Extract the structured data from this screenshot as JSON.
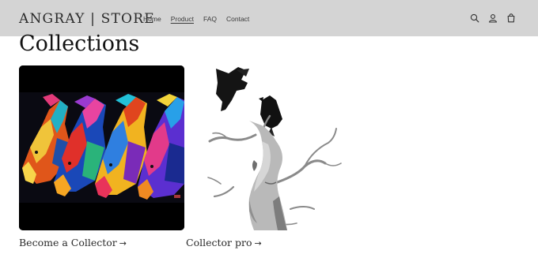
{
  "header": {
    "logo": "ANGRAY | STORE",
    "nav": [
      {
        "label": "Home",
        "active": false
      },
      {
        "label": "Product",
        "active": true
      },
      {
        "label": "FAQ",
        "active": false
      },
      {
        "label": "Contact",
        "active": false
      }
    ],
    "icons": [
      "search-icon",
      "account-icon",
      "cart-icon"
    ]
  },
  "main": {
    "title": "Collections",
    "collections": [
      {
        "label": "Become a Collector",
        "arrow": "→",
        "image": "colorful-horses-painting"
      },
      {
        "label": "Collector pro",
        "arrow": "→",
        "image": "ravens-on-sculpture"
      }
    ]
  },
  "colors": {
    "header_bg": "#d4d4d4",
    "text": "#121212"
  }
}
